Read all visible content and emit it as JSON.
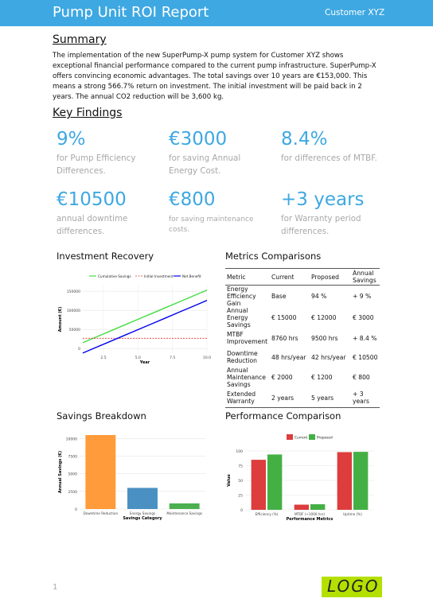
{
  "header": {
    "title": "Pump Unit ROI Report",
    "customer": "Customer XYZ"
  },
  "summary": {
    "heading": "Summary",
    "text": "The implementation of the new SuperPump-X pump system for Customer XYZ shows exceptional financial performance compared to the current pump infrastructure. SuperPump-X offers convincing economic advantages. The total savings over 10 years are €153,000. This means a strong 566.7% return on investment. The initial investment will be paid back in 2 years. The annual CO2 reduction will be 3,600 kg."
  },
  "key_findings": {
    "heading": "Key Findings",
    "items": [
      {
        "value": "9%",
        "desc": "for Pump Efficiency Differences."
      },
      {
        "value": "€3000",
        "desc": "for saving Annual Energy Cost."
      },
      {
        "value": "8.4%",
        "desc": "for differences of MTBF."
      },
      {
        "value": "€10500",
        "desc": "annual downtime differences."
      },
      {
        "value": "€800",
        "desc": "for saving maintenance costs."
      },
      {
        "value": "+3 years",
        "desc": "for Warranty period differences."
      }
    ]
  },
  "colors": {
    "accent": "#3ea8e2",
    "logo_bg": "#b4e000"
  },
  "investment": {
    "title": "Investment Recovery",
    "chart_data": {
      "type": "line",
      "xlabel": "Year",
      "ylabel": "Amount (€)",
      "x": [
        1,
        2,
        3,
        4,
        5,
        6,
        7,
        8,
        9,
        10
      ],
      "xticks": [
        "2.5",
        "5.0",
        "7.5",
        "10.0"
      ],
      "yticks": [
        "0",
        "50000",
        "100000",
        "150000"
      ],
      "xlim": [
        1,
        10
      ],
      "ylim": [
        -12000,
        165000
      ],
      "series": [
        {
          "name": "Cumulative Savings",
          "color": "#44dd44",
          "values": [
            15300,
            30600,
            45900,
            61200,
            76500,
            91800,
            107100,
            122400,
            137700,
            153000
          ]
        },
        {
          "name": "Initial Investment",
          "color": "#e03030",
          "dashed": true,
          "values": [
            27000,
            27000,
            27000,
            27000,
            27000,
            27000,
            27000,
            27000,
            27000,
            27000
          ]
        },
        {
          "name": "Net Benefit",
          "color": "#0000ee",
          "values": [
            -11700,
            3600,
            18900,
            34200,
            49500,
            64800,
            80100,
            95400,
            110700,
            126000
          ]
        }
      ]
    }
  },
  "metrics": {
    "title": "Metrics Comparisons",
    "columns": [
      "Metric",
      "Current",
      "Proposed",
      "Annual Savings"
    ],
    "rows": [
      [
        "Energy Efficiency Gain",
        "Base",
        "94 %",
        "+ 9 %"
      ],
      [
        "Annual Energy Savings",
        "€ 15000",
        "€ 12000",
        "€ 3000"
      ],
      [
        "MTBF Improvement",
        "8760 hrs",
        "9500 hrs",
        "+ 8.4 %"
      ],
      [
        "Downtime Reduction",
        "48 hrs/year",
        "42 hrs/year",
        "€ 10500"
      ],
      [
        "Annual Maintenance Savings",
        "€ 2000",
        "€ 1200",
        "€ 800"
      ],
      [
        "Extended Warranty",
        "2 years",
        "5 years",
        "+ 3 years"
      ]
    ]
  },
  "savings": {
    "title": "Savings Breakdown",
    "chart_data": {
      "type": "bar",
      "xlabel": "Savings Category",
      "ylabel": "Annual Savings (€)",
      "categories": [
        "Downtime Reduction",
        "Energy Savings",
        "Maintenance Savings"
      ],
      "values": [
        10500,
        3000,
        800
      ],
      "colors": [
        "#ff9b3a",
        "#4a90c2",
        "#4caf50"
      ],
      "yticks": [
        "0",
        "2500",
        "5000",
        "7500",
        "10000"
      ],
      "ylim": [
        0,
        10500
      ]
    }
  },
  "performance": {
    "title": "Performance Comparison",
    "chart_data": {
      "type": "bar",
      "xlabel": "Performance Metrics",
      "ylabel": "Value",
      "categories": [
        "Efficiency (%)",
        "MTBF (÷1000 hrs)",
        "Uptime (%)"
      ],
      "series": [
        {
          "name": "Current",
          "color": "#dd3d3d",
          "values": [
            85,
            8.76,
            98
          ]
        },
        {
          "name": "Proposed",
          "color": "#44b044",
          "values": [
            94,
            9.5,
            98.5
          ]
        }
      ],
      "yticks": [
        "0",
        "25",
        "50",
        "75",
        "100"
      ],
      "ylim": [
        0,
        100
      ]
    }
  },
  "footer": {
    "page": "1",
    "logo": "LOGO"
  }
}
